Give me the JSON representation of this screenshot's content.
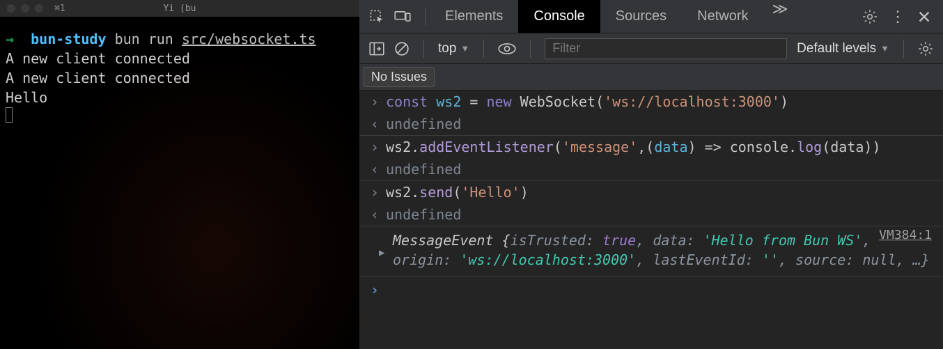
{
  "terminal": {
    "tab_shortcut": "⌘1",
    "title": "Yi (bu",
    "prompt_arrow": "→",
    "folder": "bun-study",
    "command_main": "bun run",
    "command_arg": "src/websocket.ts",
    "output": [
      "A new client connected",
      "A new client connected",
      "Hello"
    ]
  },
  "devtools": {
    "tabs": {
      "elements": "Elements",
      "console": "Console",
      "sources": "Sources",
      "network": "Network"
    },
    "toolbar": {
      "context": "top",
      "filter_placeholder": "Filter",
      "levels": "Default levels"
    },
    "issues_label": "No Issues",
    "console_lines": {
      "line1": {
        "kw": "const",
        "var": "ws2",
        "eq": " = ",
        "new": "new",
        "cls": " WebSocket",
        "open": "(",
        "str": "'ws://localhost:3000'",
        "close": ")"
      },
      "undef": "undefined",
      "line2": {
        "pre": "ws2",
        "dot1": ".",
        "fn": "addEventListener",
        "args_open": "(",
        "str": "'message'",
        "mid": ",(",
        "param": "data",
        "mid2": ") => ",
        "obj": "console",
        "dot2": ".",
        "fn2": "log",
        "open2": "(",
        "arg2": "data",
        "close": "))"
      },
      "line3": {
        "pre": "ws2",
        "dot": ".",
        "fn": "send",
        "open": "(",
        "str": "'Hello'",
        "close": ")"
      },
      "event": {
        "source": "VM384:1",
        "name": "MessageEvent ",
        "brace": "{",
        "k1": "isTrusted",
        "v1": "true",
        "k2": "data",
        "v2": "'Hello from Bun WS'",
        "k3": "origin",
        "v3": "'ws://localhost:3000'",
        "k4": "lastEventId",
        "v4": "''",
        "k5": "source",
        "v5": "null",
        "rest": ", …}"
      }
    }
  }
}
